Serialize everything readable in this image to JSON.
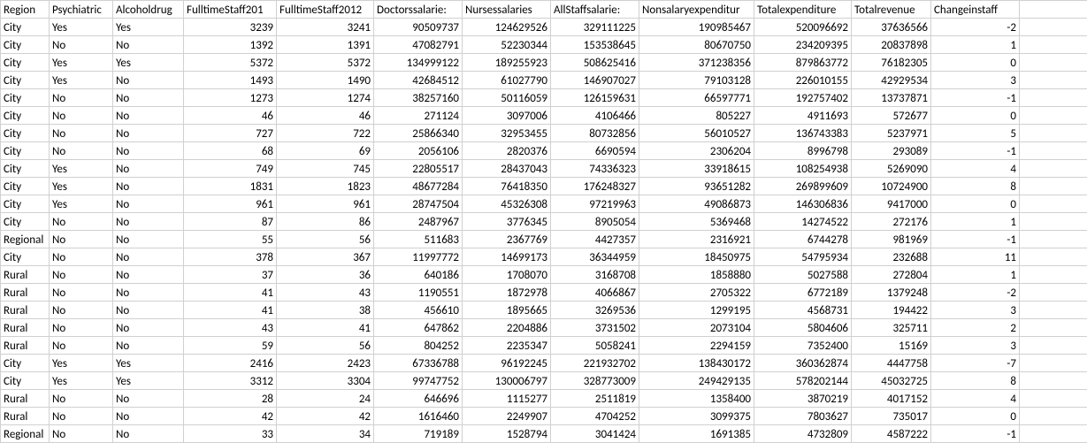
{
  "columns": [
    "Region",
    "Psychiatric",
    "Alcoholdrug",
    "FulltimeStaff201",
    "FulltimeStaff2012",
    "Doctorssalarie:",
    "Nursessalaries",
    "AllStaffsalarie:",
    "Nonsalaryexpenditur",
    "Totalexpenditure",
    "Totalrevenue",
    "Changeinstaff"
  ],
  "rows": [
    [
      "City",
      "Yes",
      "Yes",
      3239,
      3241,
      90509737,
      124629526,
      329111225,
      190985467,
      520096692,
      37636566,
      -2
    ],
    [
      "City",
      "No",
      "No",
      1392,
      1391,
      47082791,
      52230344,
      153538645,
      80670750,
      234209395,
      20837898,
      1
    ],
    [
      "City",
      "Yes",
      "Yes",
      5372,
      5372,
      134999122,
      189255923,
      508625416,
      371238356,
      879863772,
      76182305,
      0
    ],
    [
      "City",
      "Yes",
      "No",
      1493,
      1490,
      42684512,
      61027790,
      146907027,
      79103128,
      226010155,
      42929534,
      3
    ],
    [
      "City",
      "No",
      "No",
      1273,
      1274,
      38257160,
      50116059,
      126159631,
      66597771,
      192757402,
      13737871,
      -1
    ],
    [
      "City",
      "No",
      "No",
      46,
      46,
      271124,
      3097006,
      4106466,
      805227,
      4911693,
      572677,
      0
    ],
    [
      "City",
      "No",
      "No",
      727,
      722,
      25866340,
      32953455,
      80732856,
      56010527,
      136743383,
      5237971,
      5
    ],
    [
      "City",
      "No",
      "No",
      68,
      69,
      2056106,
      2820376,
      6690594,
      2306204,
      8996798,
      293089,
      -1
    ],
    [
      "City",
      "Yes",
      "No",
      749,
      745,
      22805517,
      28437043,
      74336323,
      33918615,
      108254938,
      5269090,
      4
    ],
    [
      "City",
      "Yes",
      "No",
      1831,
      1823,
      48677284,
      76418350,
      176248327,
      93651282,
      269899609,
      10724900,
      8
    ],
    [
      "City",
      "Yes",
      "No",
      961,
      961,
      28747504,
      45326308,
      97219963,
      49086873,
      146306836,
      9417000,
      0
    ],
    [
      "City",
      "No",
      "No",
      87,
      86,
      2487967,
      3776345,
      8905054,
      5369468,
      14274522,
      272176,
      1
    ],
    [
      "Regional",
      "No",
      "No",
      55,
      56,
      511683,
      2367769,
      4427357,
      2316921,
      6744278,
      981969,
      -1
    ],
    [
      "City",
      "No",
      "No",
      378,
      367,
      11997772,
      14699173,
      36344959,
      18450975,
      54795934,
      232688,
      11
    ],
    [
      "Rural",
      "No",
      "No",
      37,
      36,
      640186,
      1708070,
      3168708,
      1858880,
      5027588,
      272804,
      1
    ],
    [
      "Rural",
      "No",
      "No",
      41,
      43,
      1190551,
      1872978,
      4066867,
      2705322,
      6772189,
      1379248,
      -2
    ],
    [
      "Rural",
      "No",
      "No",
      41,
      38,
      456610,
      1895665,
      3269536,
      1299195,
      4568731,
      194422,
      3
    ],
    [
      "Rural",
      "No",
      "No",
      43,
      41,
      647862,
      2204886,
      3731502,
      2073104,
      5804606,
      325711,
      2
    ],
    [
      "Rural",
      "No",
      "No",
      59,
      56,
      804252,
      2235347,
      5058241,
      2294159,
      7352400,
      15169,
      3
    ],
    [
      "City",
      "Yes",
      "Yes",
      2416,
      2423,
      67336788,
      96192245,
      221932702,
      138430172,
      360362874,
      4447758,
      -7
    ],
    [
      "City",
      "Yes",
      "Yes",
      3312,
      3304,
      99747752,
      130006797,
      328773009,
      249429135,
      578202144,
      45032725,
      8
    ],
    [
      "Rural",
      "No",
      "No",
      28,
      24,
      646696,
      1115277,
      2511819,
      1358400,
      3870219,
      4017152,
      4
    ],
    [
      "Rural",
      "No",
      "No",
      42,
      42,
      1616460,
      2249907,
      4704252,
      3099375,
      7803627,
      735017,
      0
    ],
    [
      "Regional",
      "No",
      "No",
      33,
      34,
      719189,
      1528794,
      3041424,
      1691385,
      4732809,
      4587222,
      -1
    ]
  ],
  "numericFrom": 3
}
